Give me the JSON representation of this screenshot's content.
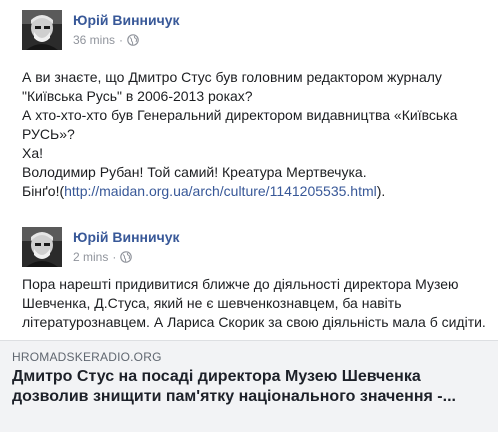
{
  "posts": [
    {
      "author": "Юрій Винничук",
      "time": "36 mins",
      "separator": "·",
      "privacy_icon": "globe-icon",
      "lines": [
        "А ви знаєте, що Дмитро Стус був головним редактором журналу",
        "\"Київська Русь\" в 2006-2013 роках?",
        "А хто-хто-хто був Генеральний директором видавництва «Київська",
        "РУСЬ»?",
        "Ха!",
        "Володимир Рубан! Той самий! Креатура Мертвечука."
      ],
      "last_line_prefix": "Бінґо!(",
      "link": "http://maidan.org.ua/arch/culture/1141205535.html",
      "last_line_suffix": ")."
    },
    {
      "author": "Юрій Винничук",
      "time": "2 mins",
      "separator": "·",
      "privacy_icon": "globe-icon",
      "lines": [
        "Пора нарешті придивитися ближче до діяльності директора Музею",
        "Шевченка, Д.Стуса, який не є шевченкознавцем, ба навіть",
        "літературознавцем. А Лариса Скорик за свою діяльність мала б сидіти."
      ],
      "link_card": {
        "domain": "HROMADSKERADIO.ORG",
        "title_lines": [
          "Дмитро Стус на посаді директора Музею Шевченка",
          "дозволив знищити пам'ятку національного значення -..."
        ]
      }
    }
  ],
  "colors": {
    "author": "#385898",
    "meta": "#90949c",
    "text": "#1c1e21",
    "card_bg": "#f2f3f5"
  }
}
